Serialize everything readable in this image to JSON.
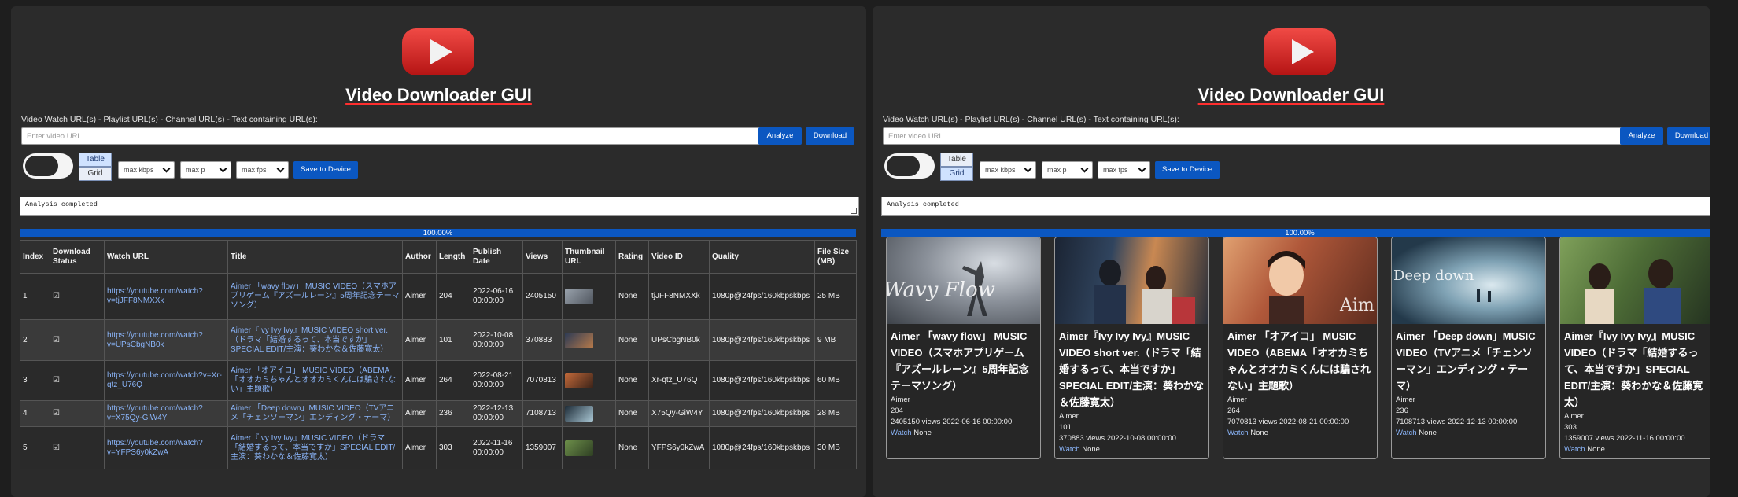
{
  "app": {
    "title": "Video Downloader GUI",
    "input_label": "Video Watch URL(s) - Playlist URL(s) - Channel URL(s) - Text containing URL(s):",
    "input_placeholder": "Enter video URL",
    "analyze_label": "Analyze",
    "download_label": "Download",
    "view_table_label": "Table",
    "view_grid_label": "Grid",
    "select_kbps": "max kbps",
    "select_p": "max p",
    "select_fps": "max fps",
    "save_label": "Save to Device",
    "status_text": "Analysis completed",
    "progress_percent": 100,
    "progress_label": "100.00%"
  },
  "colors": {
    "accent": "#0b57c1",
    "link": "#8ab4f8",
    "logo_red": "#d9201f"
  },
  "table": {
    "columns": [
      "Index",
      "Download Status",
      "Watch URL",
      "Title",
      "Author",
      "Length",
      "Publish Date",
      "Views",
      "Thumbnail URL",
      "Rating",
      "Video ID",
      "Quality",
      "File Size (MB)"
    ],
    "rows": [
      {
        "index": "1",
        "status": "☑",
        "url": "https://youtube.com/watch?v=tjJFF8NMXXk",
        "title": "Aimer 「wavy flow」 MUSIC VIDEO（スマホアプリゲーム『アズールレーン』5周年記念テーマソング）",
        "author": "Aimer",
        "length": "204",
        "date": "2022-06-16 00:00:00",
        "views": "2405150",
        "rating": "None",
        "video_id": "tjJFF8NMXXk",
        "quality": "1080p@24fps/160kbpskbps",
        "size": "25 MB",
        "thumb_color": "#6a6f78"
      },
      {
        "index": "2",
        "status": "☑",
        "url": "https://youtube.com/watch?v=UPsCbgNB0k",
        "title": "Aimer『Ivy Ivy Ivy』MUSIC VIDEO short ver.（ドラマ「結婚するって、本当ですか」SPECIAL EDIT/主演：葵わかな＆佐藤寛太）",
        "author": "Aimer",
        "length": "101",
        "date": "2022-10-08 00:00:00",
        "views": "370883",
        "rating": "None",
        "video_id": "UPsCbgNB0k",
        "quality": "1080p@24fps/160kbpskbps",
        "size": "9 MB",
        "thumb_color": "#3b4a5e"
      },
      {
        "index": "3",
        "status": "☑",
        "url": "https://youtube.com/watch?v=Xr-qtz_U76Q",
        "title": "Aimer 「オアイコ」 MUSIC VIDEO（ABEMA「オオカミちゃんとオオカミくんには騙されない」主題歌）",
        "author": "Aimer",
        "length": "264",
        "date": "2022-08-21 00:00:00",
        "views": "7070813",
        "rating": "None",
        "video_id": "Xr-qtz_U76Q",
        "quality": "1080p@24fps/160kbpskbps",
        "size": "60 MB",
        "thumb_color": "#8a4a2e"
      },
      {
        "index": "4",
        "status": "☑",
        "url": "https://youtube.com/watch?v=X75Qy-GiW4Y",
        "title": "Aimer 「Deep down」MUSIC VIDEO（TVアニメ「チェンソーマン」エンディング・テーマ）",
        "author": "Aimer",
        "length": "236",
        "date": "2022-12-13 00:00:00",
        "views": "7108713",
        "rating": "None",
        "video_id": "X75Qy-GiW4Y",
        "quality": "1080p@24fps/160kbpskbps",
        "size": "28 MB",
        "thumb_color": "#5c7a8c"
      },
      {
        "index": "5",
        "status": "☑",
        "url": "https://youtube.com/watch?v=YFPS6y0kZwA",
        "title": "Aimer『Ivy Ivy Ivy』MUSIC VIDEO（ドラマ「結婚するって、本当ですか」SPECIAL EDIT/主演：葵わかな＆佐藤寛太）",
        "author": "Aimer",
        "length": "303",
        "date": "2022-11-16 00:00:00",
        "views": "1359007",
        "rating": "None",
        "video_id": "YFPS6y0kZwA",
        "quality": "1080p@24fps/160kbpskbps",
        "size": "30 MB",
        "thumb_color": "#4b6b3a"
      }
    ]
  },
  "grid": {
    "cards": [
      {
        "title": "Aimer 「wavy flow」 MUSIC VIDEO（スマホアプリゲーム『アズールレーン』5周年記念テーマソング）",
        "author": "Aimer",
        "length": "204",
        "stats": "2405150 views 2022-06-16 00:00:00",
        "watch": "Watch",
        "rating": "None",
        "thumb_caption": "Wavy Flow",
        "thumb_bg": "#5d626b"
      },
      {
        "title": "Aimer『Ivy Ivy Ivy』MUSIC VIDEO short ver.（ドラマ「結婚するって、本当ですか」SPECIAL EDIT/主演：葵わかな＆佐藤寛太）",
        "author": "Aimer",
        "length": "101",
        "stats": "370883 views 2022-10-08 00:00:00",
        "watch": "Watch",
        "rating": "None",
        "thumb_caption": "",
        "thumb_bg": "#33465c"
      },
      {
        "title": "Aimer 「オアイコ」 MUSIC VIDEO（ABEMA「オオカミちゃんとオオカミくんには騙されない」主題歌）",
        "author": "Aimer",
        "length": "264",
        "stats": "7070813 views 2022-08-21 00:00:00",
        "watch": "Watch",
        "rating": "None",
        "thumb_caption": "Aim",
        "thumb_bg": "#8e4b30"
      },
      {
        "title": "Aimer 「Deep down」MUSIC VIDEO（TVアニメ「チェンソーマン」エンディング・テーマ）",
        "author": "Aimer",
        "length": "236",
        "stats": "7108713 views 2022-12-13 00:00:00",
        "watch": "Watch",
        "rating": "None",
        "thumb_caption": "Deep down",
        "thumb_bg": "#55758a"
      },
      {
        "title": "Aimer『Ivy Ivy Ivy』MUSIC VIDEO（ドラマ「結婚するって、本当ですか」SPECIAL EDIT/主演：葵わかな＆佐藤寛太）",
        "author": "Aimer",
        "length": "303",
        "stats": "1359007 views 2022-11-16 00:00:00",
        "watch": "Watch",
        "rating": "None",
        "thumb_caption": "",
        "thumb_bg": "#466236"
      }
    ]
  }
}
